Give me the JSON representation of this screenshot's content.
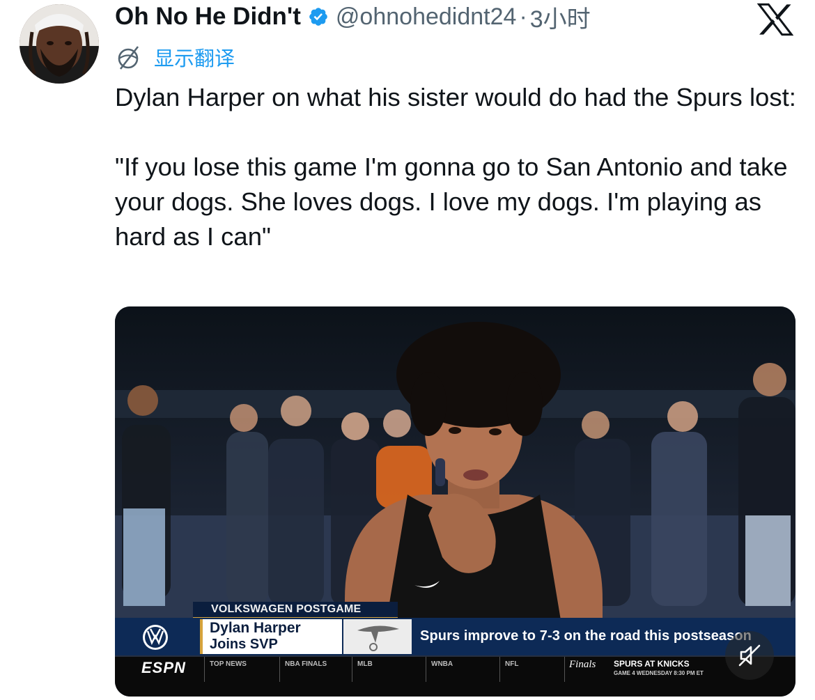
{
  "author": {
    "display_name": "Oh No He Didn't",
    "handle": "@ohnohedidnt24",
    "separator": "·",
    "time": "3小时",
    "verified": true,
    "avatar_icon": "avatar-photo"
  },
  "translate": {
    "label": "显示翻译",
    "icon": "translate-globe-icon"
  },
  "tweet": {
    "line1": "Dylan Harper on what his sister would do had the Spurs lost:",
    "line2": "\"If you lose this game I'm gonna go to San Antonio and take your dogs. She loves dogs. I love my dogs. I'm playing as hard as I can\""
  },
  "video": {
    "segment_label": "VOLKSWAGEN POSTGAME",
    "name_line1": "Dylan Harper",
    "name_line2": "Joins SVP",
    "headline": "Spurs improve to 7-3 on the road this postseason",
    "network": "ESPN",
    "ticker": [
      "TOP NEWS",
      "NBA FINALS",
      "MLB",
      "WNBA",
      "NFL"
    ],
    "finals_label": "Finals",
    "matchup": "SPURS AT KNICKS",
    "matchup_sub": "GAME 4 WEDNESDAY 8:30 PM ET",
    "muted": true
  },
  "colors": {
    "link": "#1d9bf0",
    "handle_gray": "#536471",
    "espn_navy": "#0d2a56",
    "gold": "#d6a33c"
  }
}
